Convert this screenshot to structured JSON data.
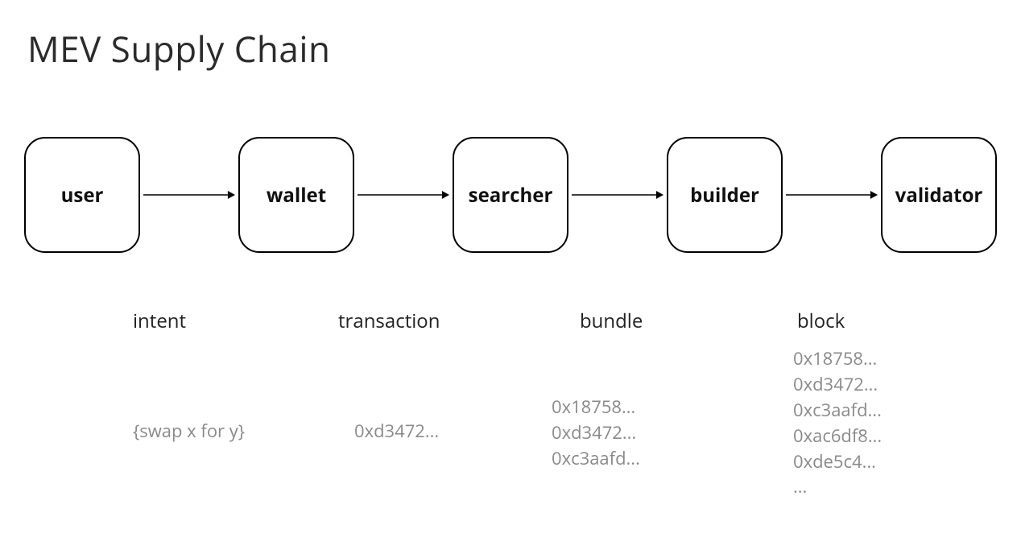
{
  "title": "MEV Supply Chain",
  "nodes": {
    "user": "user",
    "wallet": "wallet",
    "searcher": "searcher",
    "builder": "builder",
    "validator": "validator"
  },
  "columns": {
    "c1": {
      "label": "intent",
      "details": [
        "{swap x for y}"
      ]
    },
    "c2": {
      "label": "transaction",
      "details": [
        "0xd3472..."
      ]
    },
    "c3": {
      "label": "bundle",
      "details": [
        "0x18758...",
        "0xd3472...",
        "0xc3aafd..."
      ]
    },
    "c4": {
      "label": "block",
      "details": [
        "0x18758...",
        "0xd3472...",
        "0xc3aafd...",
        "0xac6df8...",
        "0xde5c4...",
        "..."
      ]
    }
  }
}
